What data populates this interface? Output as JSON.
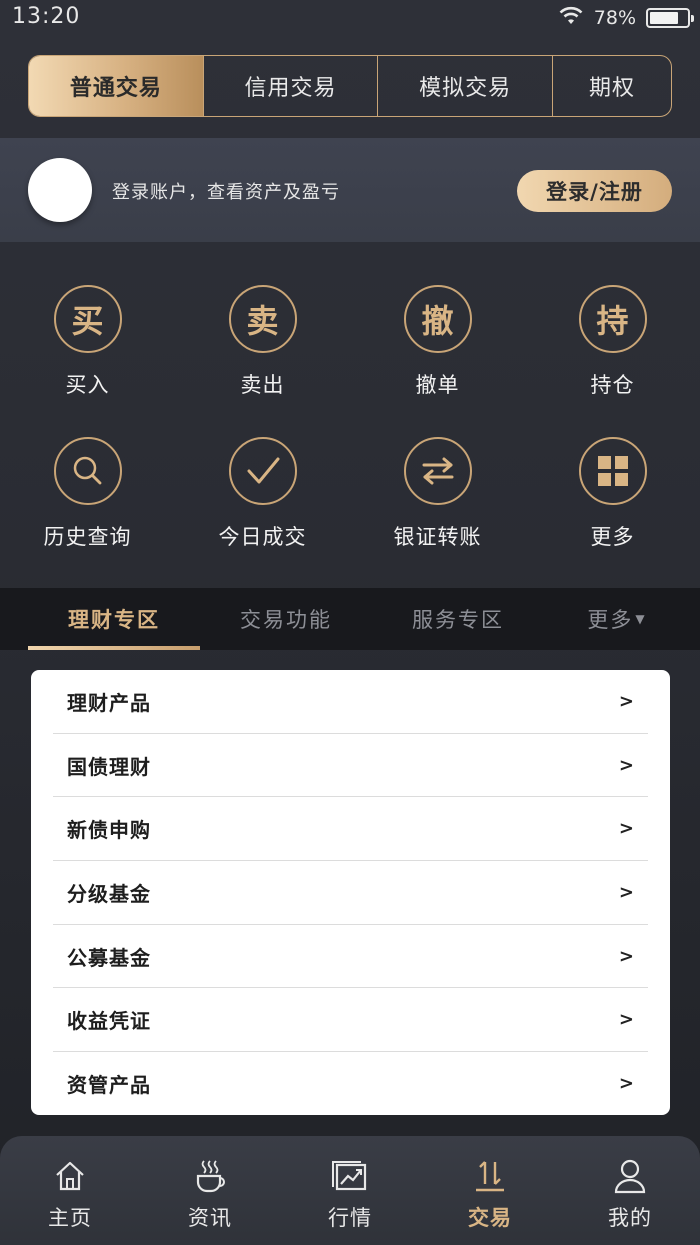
{
  "status_bar": {
    "time": "13:20",
    "battery": "78%",
    "battery_level": 0.78
  },
  "trade_modes": [
    {
      "label": "普通交易",
      "active": true
    },
    {
      "label": "信用交易",
      "active": false
    },
    {
      "label": "模拟交易",
      "active": false
    },
    {
      "label": "期权",
      "active": false
    }
  ],
  "login": {
    "hint": "登录账户，查看资产及盈亏",
    "button": "登录/注册"
  },
  "functions": [
    {
      "glyph": "买",
      "label": "买入",
      "icon": "buy-icon"
    },
    {
      "glyph": "卖",
      "label": "卖出",
      "icon": "sell-icon"
    },
    {
      "glyph": "撤",
      "label": "撤单",
      "icon": "cancel-order-icon"
    },
    {
      "glyph": "持",
      "label": "持仓",
      "icon": "position-icon"
    },
    {
      "glyph": "",
      "label": "历史查询",
      "icon": "search-icon"
    },
    {
      "glyph": "",
      "label": "今日成交",
      "icon": "check-icon"
    },
    {
      "glyph": "",
      "label": "银证转账",
      "icon": "transfer-icon"
    },
    {
      "glyph": "",
      "label": "更多",
      "icon": "grid-icon"
    }
  ],
  "sub_tabs": [
    {
      "label": "理财专区",
      "active": true
    },
    {
      "label": "交易功能",
      "active": false
    },
    {
      "label": "服务专区",
      "active": false
    },
    {
      "label": "更多",
      "active": false
    }
  ],
  "products": [
    {
      "label": "理财产品",
      "arrow": ">"
    },
    {
      "label": "国债理财",
      "arrow": ">"
    },
    {
      "label": "新债申购",
      "arrow": ">"
    },
    {
      "label": "分级基金",
      "arrow": ">"
    },
    {
      "label": "公募基金",
      "arrow": ">"
    },
    {
      "label": "收益凭证",
      "arrow": ">"
    },
    {
      "label": "资管产品",
      "arrow": ">"
    }
  ],
  "bottom_nav": [
    {
      "label": "主页",
      "icon": "home-icon",
      "active": false
    },
    {
      "label": "资讯",
      "icon": "coffee-icon",
      "active": false
    },
    {
      "label": "行情",
      "icon": "chart-icon",
      "active": false
    },
    {
      "label": "交易",
      "icon": "trade-arrows-icon",
      "active": true
    },
    {
      "label": "我的",
      "icon": "user-icon",
      "active": false
    }
  ],
  "colors": {
    "gold": "#d9b585",
    "gold_light": "#f2d9b3",
    "bg": "#2a2c33"
  }
}
